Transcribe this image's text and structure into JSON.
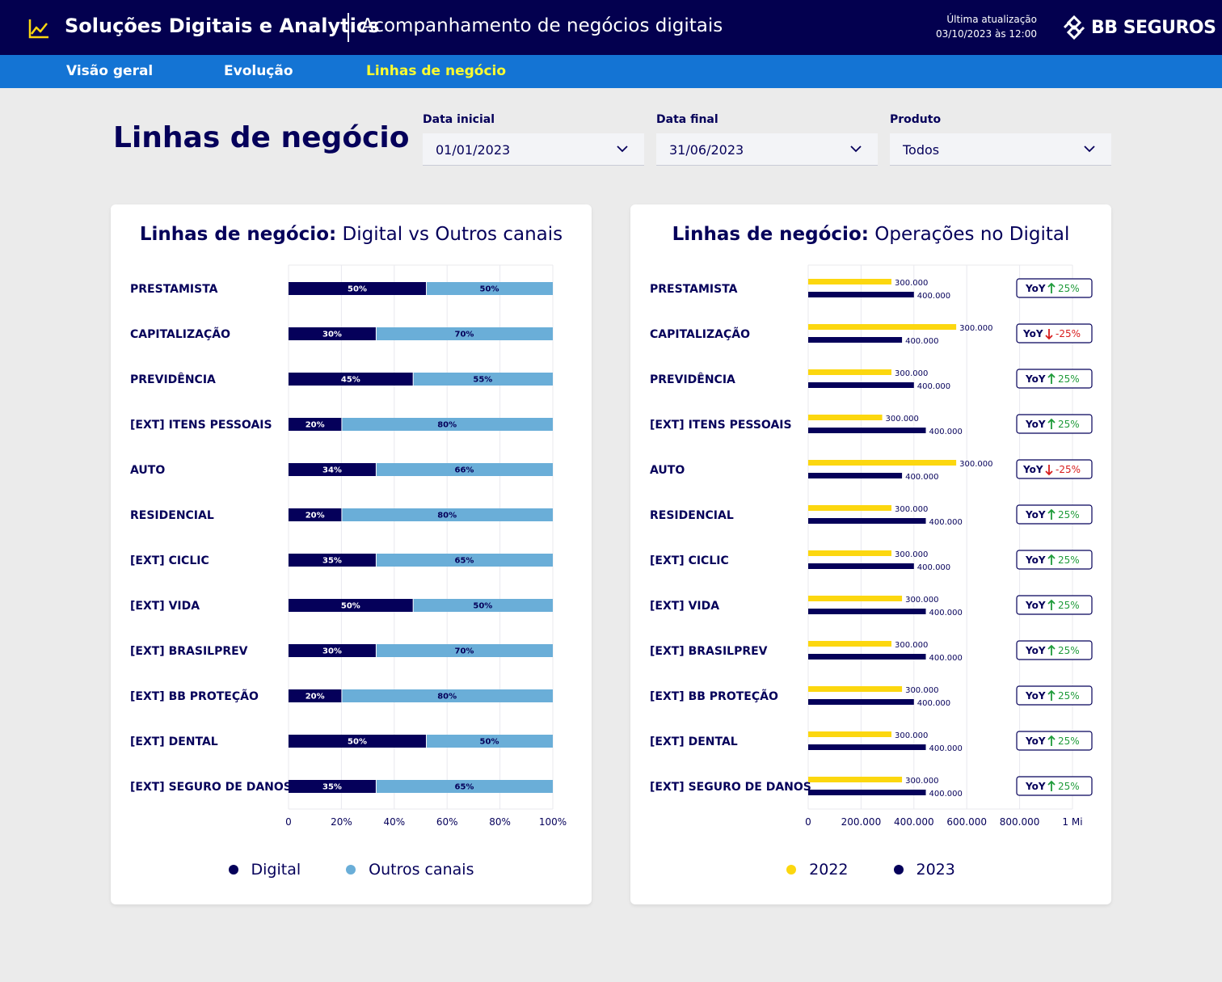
{
  "header": {
    "app_title": "Soluções Digitais e Analytics",
    "subtitle": "Acompanhamento de negócios digitais",
    "last_update_label": "Última atualização",
    "last_update_value": "03/10/2023 às 12:00",
    "brand": "BB SEGUROS",
    "logo_icon": "line-chart-icon"
  },
  "nav": {
    "tabs": [
      {
        "label": "Visão geral",
        "active": false
      },
      {
        "label": "Evolução",
        "active": false
      },
      {
        "label": "Linhas de negócio",
        "active": true
      }
    ]
  },
  "page": {
    "title": "Linhas de negócio"
  },
  "filters": [
    {
      "label": "Data inicial",
      "value": "01/01/2023"
    },
    {
      "label": "Data final",
      "value": "31/06/2023"
    },
    {
      "label": "Produto",
      "value": "Todos"
    }
  ],
  "colors": {
    "navy": "#05005a",
    "light_blue": "#6aaed8",
    "yellow": "#fcd70f",
    "up_green": "#1f9b3a",
    "down_red": "#d81d1d"
  },
  "chart_data": [
    {
      "type": "bar",
      "orientation": "horizontal",
      "stacked": true,
      "title_bold": "Linhas de negócio:",
      "title_rest": "Digital vs Outros canais",
      "categories": [
        "PRESTAMISTA",
        "CAPITALIZAÇÃO",
        "PREVIDÊNCIA",
        "[EXT] ITENS PESSOAIS",
        "AUTO",
        "RESIDENCIAL",
        "[EXT] CICLIC",
        "[EXT] VIDA",
        "[EXT] BRASILPREV",
        "[EXT] BB PROTEÇÃO",
        "[EXT] DENTAL",
        "[EXT] SEGURO DE DANOS"
      ],
      "series": [
        {
          "name": "Digital",
          "values": [
            50,
            30,
            45,
            20,
            34,
            20,
            35,
            50,
            30,
            20,
            50,
            35
          ],
          "bar_lengths": [
            52,
            33,
            47,
            20,
            33,
            20,
            33,
            47,
            33,
            20,
            52,
            33
          ],
          "labels": [
            "50%",
            "30%",
            "45%",
            "20%",
            "34%",
            "20%",
            "35%",
            "50%",
            "30%",
            "20%",
            "50%",
            "35%"
          ],
          "color": "#05005a"
        },
        {
          "name": "Outros canais",
          "values": [
            50,
            70,
            55,
            80,
            66,
            80,
            65,
            50,
            70,
            80,
            50,
            65
          ],
          "labels": [
            "50%",
            "70%",
            "55%",
            "80%",
            "66%",
            "80%",
            "65%",
            "50%",
            "70%",
            "80%",
            "50%",
            "65%"
          ],
          "color": "#6aaed8"
        }
      ],
      "xlim": [
        0,
        100
      ],
      "xticks": [
        "0",
        "20%",
        "40%",
        "60%",
        "80%",
        "100%"
      ],
      "legend": [
        "Digital",
        "Outros canais"
      ],
      "legend_position": "bottom",
      "grid": true
    },
    {
      "type": "bar",
      "orientation": "horizontal",
      "grouped": true,
      "title_bold": "Linhas de negócio:",
      "title_rest": "Operações no Digital",
      "categories": [
        "PRESTAMISTA",
        "CAPITALIZAÇÃO",
        "PREVIDÊNCIA",
        "[EXT] ITENS PESSOAIS",
        "AUTO",
        "RESIDENCIAL",
        "[EXT] CICLIC",
        "[EXT] VIDA",
        "[EXT] BRASILPREV",
        "[EXT] BB PROTEÇÃO",
        "[EXT] DENTAL",
        "[EXT] SEGURO DE DANOS"
      ],
      "series": [
        {
          "name": "2022",
          "values": [
            315000,
            560000,
            315000,
            280000,
            560000,
            315000,
            315000,
            355000,
            315000,
            355000,
            315000,
            355000
          ],
          "labels": [
            "300.000",
            "300.000",
            "300.000",
            "300.000",
            "300.000",
            "300.000",
            "300.000",
            "300.000",
            "300.000",
            "300.000",
            "300.000",
            "300.000"
          ],
          "color": "#fcd70f"
        },
        {
          "name": "2023",
          "values": [
            400000,
            355000,
            400000,
            445000,
            355000,
            445000,
            400000,
            445000,
            445000,
            400000,
            445000,
            445000
          ],
          "labels": [
            "400.000",
            "400.000",
            "400.000",
            "400.000",
            "400.000",
            "400.000",
            "400.000",
            "400.000",
            "400.000",
            "400.000",
            "400.000",
            "400.000"
          ],
          "color": "#05005a"
        }
      ],
      "yoy": [
        {
          "label": "YoY",
          "direction": "up",
          "value": "25%"
        },
        {
          "label": "YoY",
          "direction": "down",
          "value": "-25%"
        },
        {
          "label": "YoY",
          "direction": "up",
          "value": "25%"
        },
        {
          "label": "YoY",
          "direction": "up",
          "value": "25%"
        },
        {
          "label": "YoY",
          "direction": "down",
          "value": "-25%"
        },
        {
          "label": "YoY",
          "direction": "up",
          "value": "25%"
        },
        {
          "label": "YoY",
          "direction": "up",
          "value": "25%"
        },
        {
          "label": "YoY",
          "direction": "up",
          "value": "25%"
        },
        {
          "label": "YoY",
          "direction": "up",
          "value": "25%"
        },
        {
          "label": "YoY",
          "direction": "up",
          "value": "25%"
        },
        {
          "label": "YoY",
          "direction": "up",
          "value": "25%"
        },
        {
          "label": "YoY",
          "direction": "up",
          "value": "25%"
        }
      ],
      "xlim": [
        0,
        1000000
      ],
      "xticks": [
        "0",
        "200.000",
        "400.000",
        "600.000",
        "800.000",
        "1 Mi"
      ],
      "legend": [
        "2022",
        "2023"
      ],
      "legend_position": "bottom",
      "grid": true
    }
  ]
}
